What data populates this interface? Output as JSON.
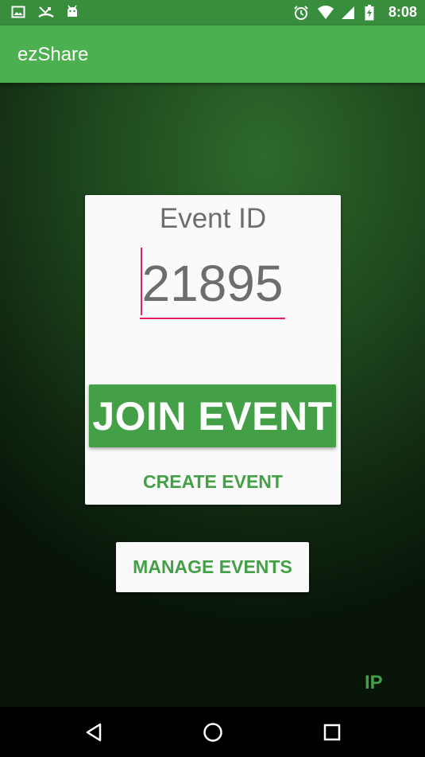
{
  "status_bar": {
    "time": "8:08",
    "left_icons": [
      "image-icon",
      "missed-call-icon",
      "android-icon"
    ],
    "right_icons": [
      "alarm-icon",
      "wifi-icon",
      "signal-icon",
      "battery-icon"
    ]
  },
  "app_bar": {
    "title": "ezShare"
  },
  "card": {
    "event_id_label": "Event ID",
    "event_id_value": "21895",
    "join_label": "JOIN EVENT",
    "create_label": "CREATE EVENT"
  },
  "manage_label": "MANAGE EVENTS",
  "ip_label": "IP",
  "nav_bar": {
    "buttons": [
      "back-icon",
      "home-icon",
      "recents-icon"
    ]
  },
  "colors": {
    "primary": "#4caf50",
    "primary_dark": "#388e3c",
    "accent": "#43a047",
    "input_accent": "#e91e63",
    "card_bg": "#fafafa"
  }
}
